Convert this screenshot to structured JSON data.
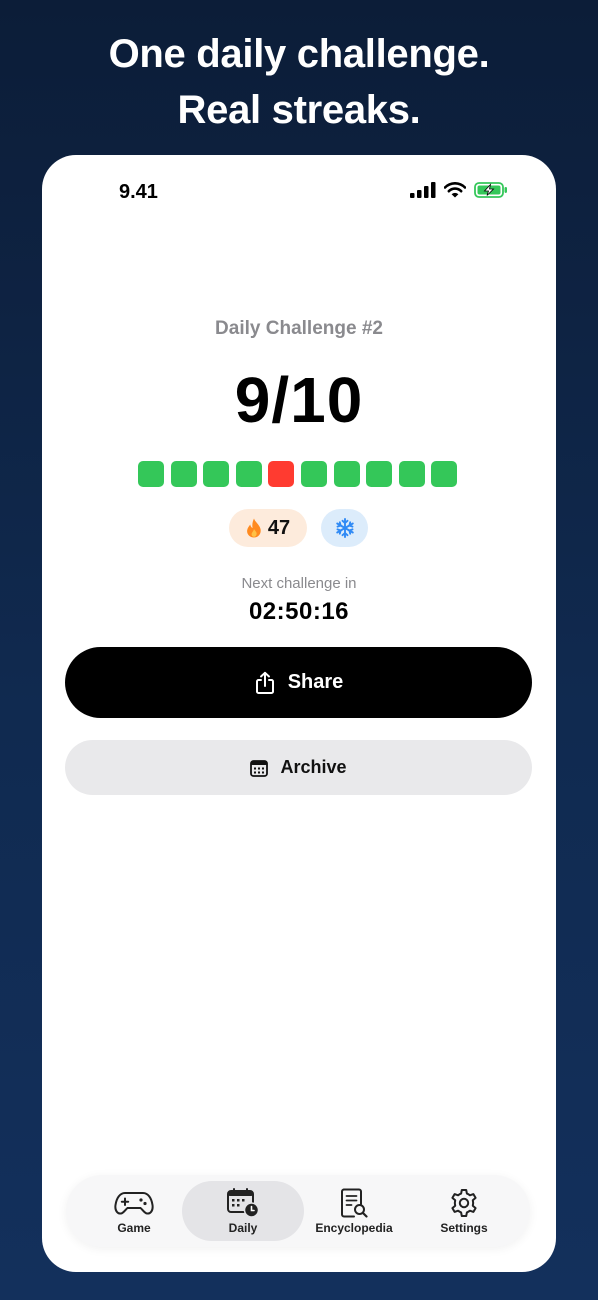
{
  "headline": {
    "line1": "One daily challenge.",
    "line2": "Real streaks."
  },
  "status_bar": {
    "time": "9.41",
    "icons": [
      "signal-icon",
      "wifi-icon",
      "battery-charging-icon"
    ]
  },
  "daily": {
    "title": "Daily Challenge #2",
    "score": "9/10",
    "results": [
      true,
      true,
      true,
      true,
      false,
      true,
      true,
      true,
      true,
      true
    ],
    "streak_count": "47",
    "streak_icon": "flame-icon",
    "freeze_icon": "snowflake-icon",
    "next_label": "Next challenge in",
    "countdown": "02:50:16"
  },
  "actions": {
    "share_label": "Share",
    "archive_label": "Archive"
  },
  "tabs": [
    {
      "label": "Game",
      "icon": "gamepad-icon",
      "active": false
    },
    {
      "label": "Daily",
      "icon": "calendar-clock-icon",
      "active": true
    },
    {
      "label": "Encyclopedia",
      "icon": "document-search-icon",
      "active": false
    },
    {
      "label": "Settings",
      "icon": "gear-icon",
      "active": false
    }
  ],
  "colors": {
    "correct": "#34c759",
    "incorrect": "#ff3b30",
    "background_top": "#0c1d38",
    "background_bottom": "#13305c"
  }
}
